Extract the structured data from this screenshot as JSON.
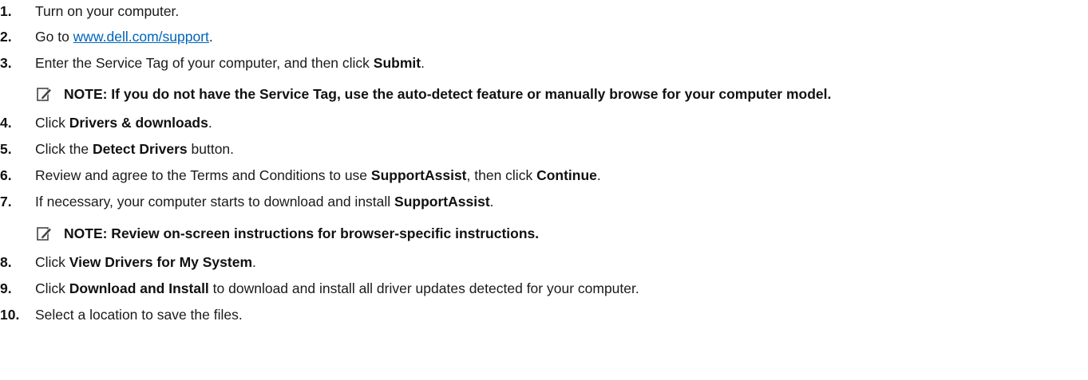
{
  "steps": [
    {
      "num": "1.",
      "text": "Turn on your computer."
    },
    {
      "num": "2.",
      "pre": "Go to ",
      "link": "www.dell.com/support",
      "post": "."
    },
    {
      "num": "3.",
      "pre": "Enter the Service Tag of your computer, and then click ",
      "bold": "Submit",
      "post": "."
    },
    {
      "num": "4.",
      "pre": "Click ",
      "bold": "Drivers & downloads",
      "post": "."
    },
    {
      "num": "5.",
      "pre": "Click the ",
      "bold": "Detect Drivers",
      "post": " button."
    },
    {
      "num": "6.",
      "pre": "Review and agree to the Terms and Conditions to use ",
      "bold": "SupportAssist",
      "mid": ", then click ",
      "bold2": "Continue",
      "post": "."
    },
    {
      "num": "7.",
      "pre": "If necessary, your computer starts to download and install ",
      "bold": "SupportAssist",
      "post": "."
    },
    {
      "num": "8.",
      "pre": "Click ",
      "bold": "View Drivers for My System",
      "post": "."
    },
    {
      "num": "9.",
      "pre": "Click ",
      "bold": "Download and Install",
      "post": " to download and install all driver updates detected for your computer."
    },
    {
      "num": "10.",
      "text": "Select a location to save the files."
    }
  ],
  "notes": [
    {
      "text": "NOTE: If you do not have the Service Tag, use the auto-detect feature or manually browse for your computer model."
    },
    {
      "text": "NOTE: Review on-screen instructions for browser-specific instructions."
    }
  ],
  "icons": {
    "note": "pencil-note-icon"
  }
}
